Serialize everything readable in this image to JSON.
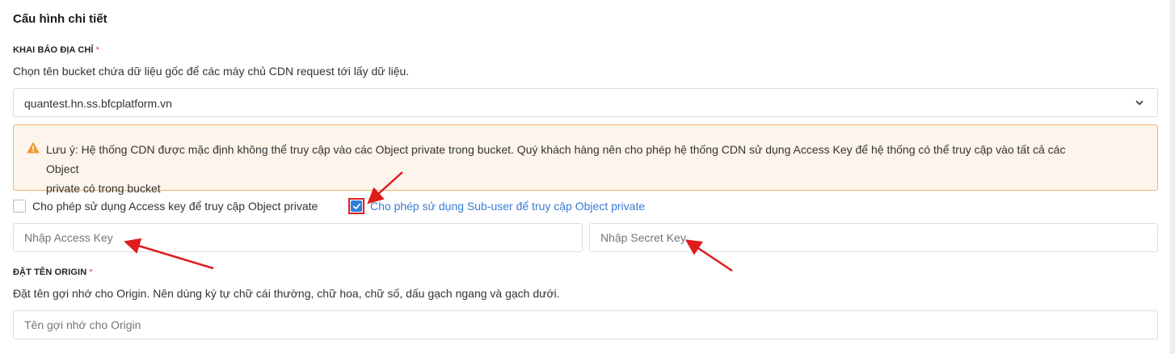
{
  "section": {
    "title": "Cấu hình chi tiết"
  },
  "address": {
    "label": "KHAI BÁO ĐỊA CHỈ",
    "required_mark": "*",
    "hint": "Chọn tên bucket chứa dữ liệu gốc để các máy chủ CDN request tới lấy dữ liệu.",
    "selected_bucket": "quantest.hn.ss.bfcplatform.vn",
    "dropdown_icon": "chevron-down-icon"
  },
  "alert": {
    "icon": "warning-icon",
    "color": "#f0b36a",
    "line1": "Lưu ý: Hệ thống CDN được mặc định không thể truy cập vào các Object private trong bucket. Quý khách hàng nên cho phép hệ thống CDN sử dụng Access Key để hệ thống có thể truy cập vào tất cả các Object",
    "line2": "private có trong bucket"
  },
  "options": {
    "access_key": {
      "label": "Cho phép sử dụng Access key để truy cập Object private",
      "checked": false
    },
    "sub_user": {
      "label": "Cho phép sử dụng Sub-user để truy cập Object private",
      "checked": true
    }
  },
  "keys": {
    "access_key_placeholder": "Nhập Access Key",
    "access_key_value": "",
    "secret_key_placeholder": "Nhập Secret Key",
    "secret_key_value": ""
  },
  "origin": {
    "label": "ĐẶT TÊN ORIGIN",
    "required_mark": "*",
    "hint": "Đặt tên gợi nhớ cho Origin. Nên dùng ký tự chữ cái thường, chữ hoa, chữ số, dấu gạch ngang và gạch dưới.",
    "name_placeholder": "Tên gợi nhớ cho Origin",
    "name_value": ""
  },
  "colors": {
    "accent": "#2f7ce0",
    "annotation": "#e01b1b",
    "required": "#e03a3a"
  }
}
